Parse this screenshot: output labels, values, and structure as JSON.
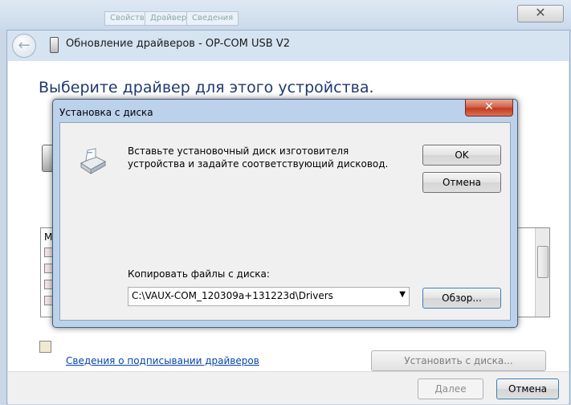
{
  "background": {
    "tabs": [
      "Свойства",
      "Драйвер",
      "Сведения"
    ]
  },
  "wizard": {
    "title": "Обновление драйверов - OP-COM USB V2",
    "heading": "Выберите драйвер для этого устройства.",
    "list_header": "М",
    "signing_link": "Сведения о подписывании драйверов",
    "have_disk_label": "Установить с диска...",
    "next_label": "Далее",
    "cancel_label": "Отмена"
  },
  "dialog": {
    "title": "Установка с диска",
    "message": "Вставьте установочный диск изготовителя\nустройства и задайте соответствующий дисковод.",
    "ok_label": "OK",
    "cancel_label": "Отмена",
    "copy_label": "Копировать файлы с диска:",
    "path_value": "C:\\VAUX-COM_120309a+131223d\\Drivers",
    "browse_label": "Обзор..."
  },
  "icons": {
    "close": "close-icon",
    "back": "back-arrow-icon",
    "dropdown": "chevron-down-icon",
    "printer": "printer-icon",
    "device": "usb-device-icon"
  }
}
